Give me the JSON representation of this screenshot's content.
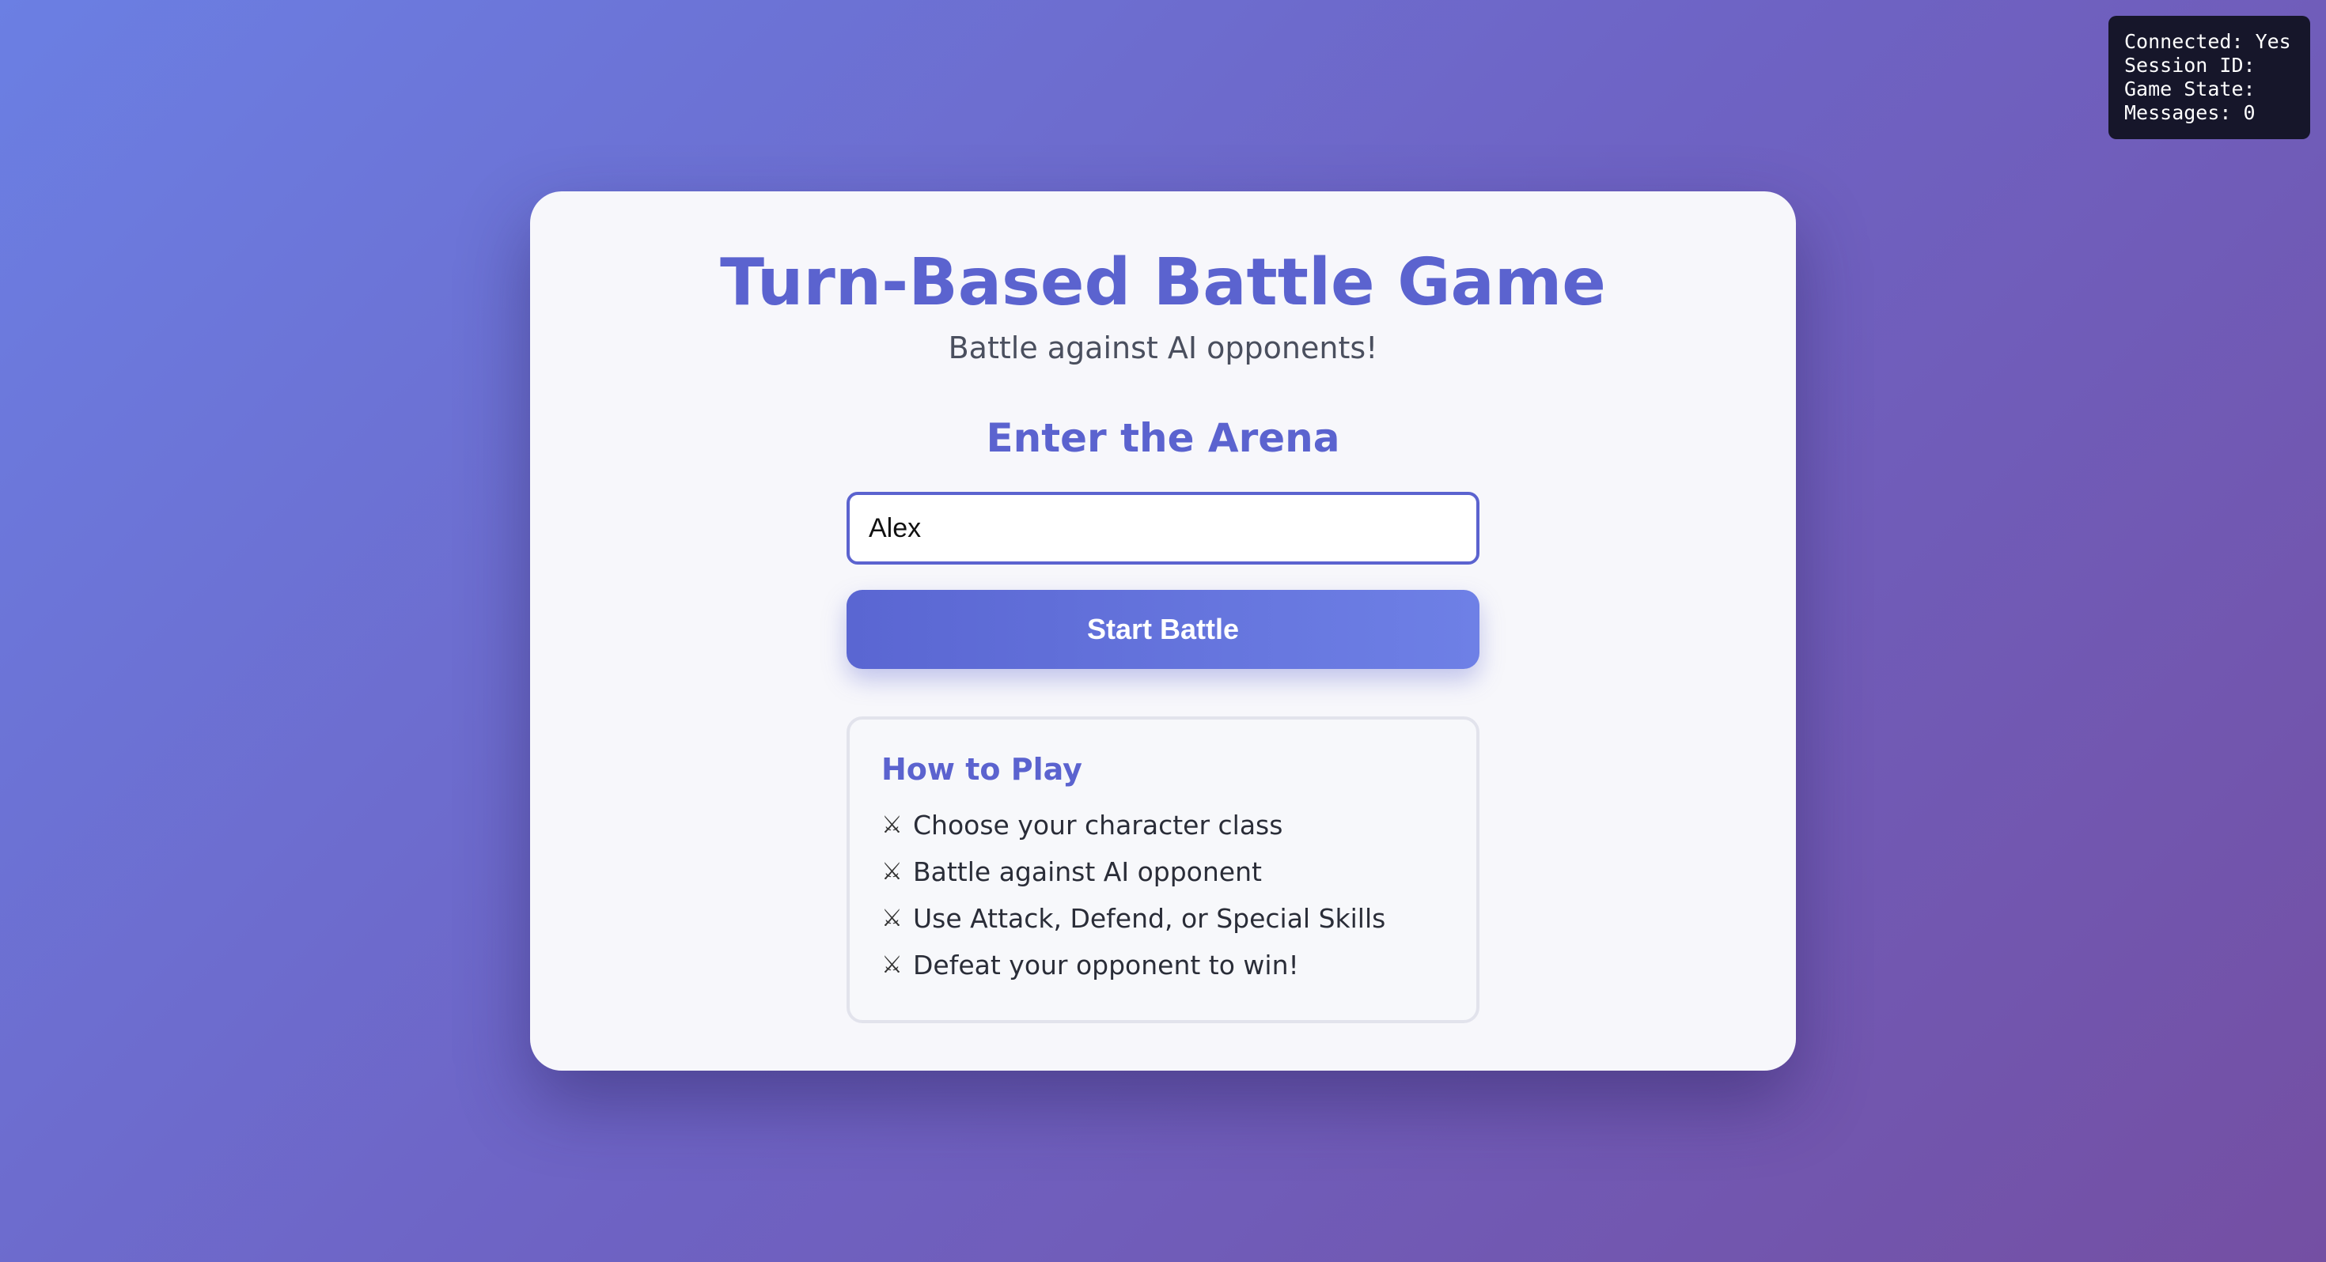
{
  "debug": {
    "lines": [
      "Connected: Yes",
      "Session ID:",
      "Game State:",
      "Messages: 0"
    ]
  },
  "card": {
    "title": "Turn-Based Battle Game",
    "subtitle": "Battle against AI opponents!",
    "arena_heading": "Enter the Arena",
    "name_input": {
      "value": "Alex",
      "placeholder": ""
    },
    "start_button_label": "Start Battle"
  },
  "how_to_play": {
    "title": "How to Play",
    "icon": "crossed-swords-icon",
    "items": [
      "Choose your character class",
      "Battle against AI opponent",
      "Use Attack, Defend, or Special Skills",
      "Defeat your opponent to win!"
    ]
  },
  "colors": {
    "accent": "#5b63cf",
    "background_start": "#6b7fe3",
    "background_end": "#744fa3",
    "card": "#f7f7fb",
    "debug_bg": "#16162a"
  }
}
